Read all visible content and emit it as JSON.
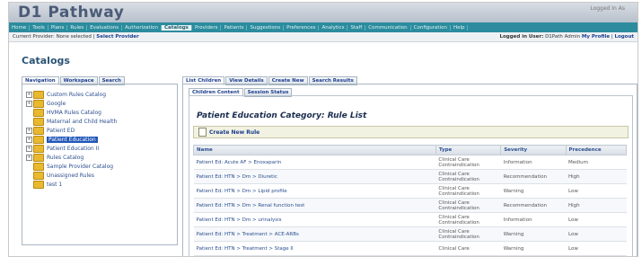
{
  "app": {
    "logo": "D1 Pathway",
    "header_right": "Logged In As"
  },
  "navbar": {
    "items": [
      "Home",
      "Tools",
      "Plans",
      "Rules",
      "Evaluations",
      "Authorization",
      "Catalogs",
      "Providers",
      "Patients",
      "Suggestions",
      "Preferences",
      "Analytics",
      "Staff",
      "Communication",
      "Configuration",
      "Help"
    ],
    "active_index": 6
  },
  "status": {
    "current_provider_label": "Current Provider:",
    "current_provider_value": "None selected",
    "select_provider": "Select Provider",
    "logged_in_label": "Logged in User:",
    "logged_in_value": "D1Path Admin",
    "my_profile": "My Profile",
    "logout": "Logout"
  },
  "page": {
    "title": "Catalogs"
  },
  "left_tabs": [
    "Navigation",
    "Workspace",
    "Search"
  ],
  "tree": {
    "items": [
      {
        "label": "Custom Rules Catalog",
        "expandable": true
      },
      {
        "label": "Google",
        "expandable": true
      },
      {
        "label": "HVMA Rules Catalog",
        "expandable": false
      },
      {
        "label": "Maternal and Child Health",
        "expandable": false
      },
      {
        "label": "Patient ED",
        "expandable": true
      },
      {
        "label": "Patient Education",
        "expandable": true,
        "selected": true
      },
      {
        "label": "Patient Education II",
        "expandable": true
      },
      {
        "label": "Rules Catalog",
        "expandable": true
      },
      {
        "label": "Sample Provider Catalog",
        "expandable": false
      },
      {
        "label": "Unassigned Rules",
        "expandable": false
      },
      {
        "label": "test 1",
        "expandable": false
      }
    ]
  },
  "right_tabs": [
    "List Children",
    "View Details",
    "Create New",
    "Search Results"
  ],
  "sub_tabs": [
    "Children Content",
    "Session Status"
  ],
  "section_title": "Patient Education Category: Rule List",
  "create_button": "Create New Rule",
  "table": {
    "headers": [
      "Name",
      "Type",
      "Severity",
      "Precedence"
    ],
    "rows": [
      [
        "Patient Ed: Acute AF > Enoxaparin",
        "Clinical Care Contraindication",
        "Information",
        "Medium"
      ],
      [
        "Patient Ed: HTN > Dm > Diuretic",
        "Clinical Care Contraindication",
        "Recommendation",
        "High"
      ],
      [
        "Patient Ed: HTN > Dm > Lipid profile",
        "Clinical Care Contraindication",
        "Warning",
        "Low"
      ],
      [
        "Patient Ed: HTN > Dm > Renal function test",
        "Clinical Care Contraindication",
        "Recommendation",
        "High"
      ],
      [
        "Patient Ed: HTN > Dm > urinalysis",
        "Clinical Care Contraindication",
        "Information",
        "Low"
      ],
      [
        "Patient Ed: HTN > Treatment > ACE-ARBs",
        "Clinical Care Contraindication",
        "Warning",
        "Low"
      ],
      [
        "Patient Ed: HTN > Treatment > Stage II",
        "Clinical Care",
        "Warning",
        "Low"
      ]
    ]
  }
}
